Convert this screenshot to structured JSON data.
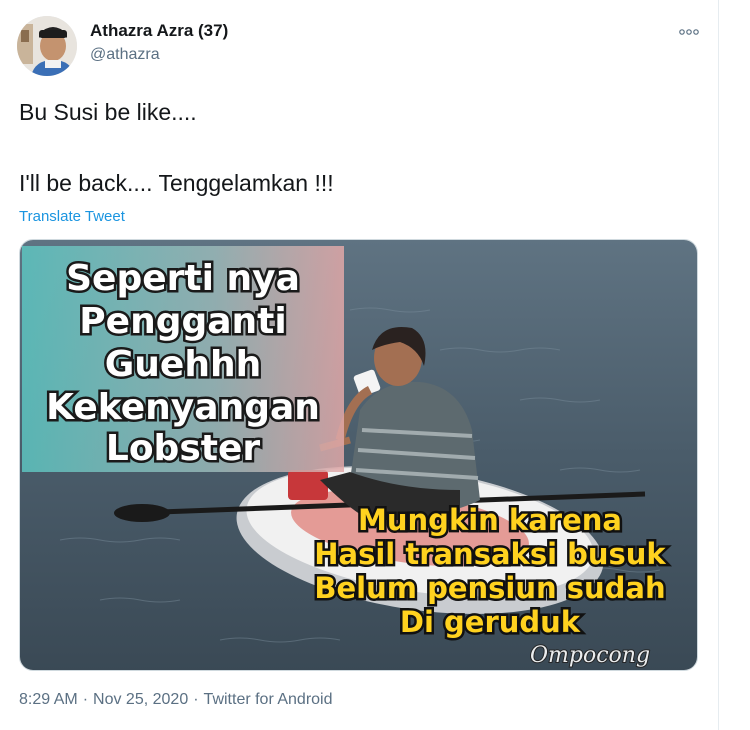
{
  "author": {
    "name": "Athazra Azra (37)",
    "handle": "@athazra"
  },
  "tweet": {
    "line1": "Bu Susi be like....",
    "line2": "I'll be back.... Tenggelamkan !!!",
    "translate_label": "Translate Tweet"
  },
  "media": {
    "caption_top": [
      "Seperti nya",
      "Pengganti",
      "Guehhh",
      "Kekenyangan",
      "Lobster"
    ],
    "caption_bottom": [
      "Mungkin karena",
      "Hasil transaksi busuk",
      "Belum pensiun sudah",
      "Di geruduk"
    ],
    "watermark": "Ompocong"
  },
  "meta": {
    "time": "8:29 AM",
    "date": "Nov 25, 2020",
    "source": "Twitter for Android",
    "separator": "·"
  },
  "colors": {
    "link": "#1b95e0",
    "muted": "#5b7083",
    "caption_bottom": "#ffd21f"
  },
  "icons": {
    "more": "more-options-icon"
  }
}
